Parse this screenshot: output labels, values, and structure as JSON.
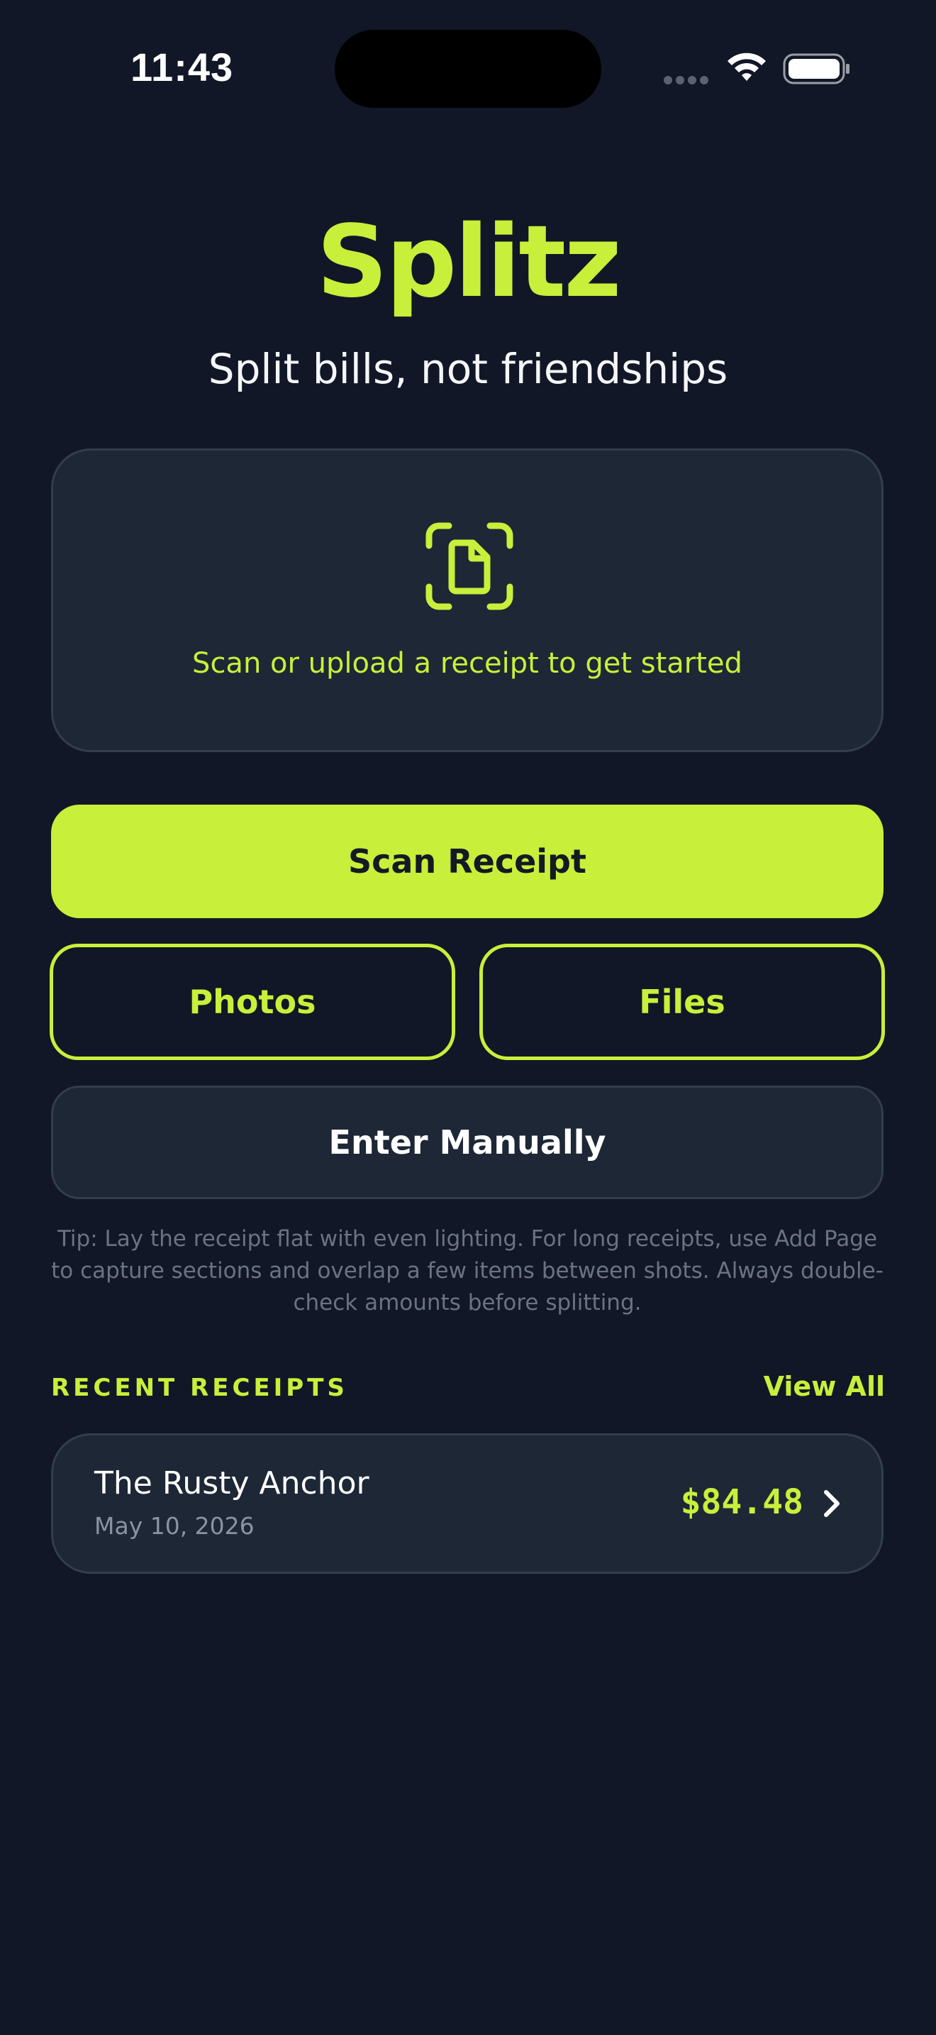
{
  "status_bar": {
    "time": "11:43"
  },
  "header": {
    "title": "Splitz",
    "tagline": "Split bills, not friendships"
  },
  "upload_card": {
    "icon": "document-scan-icon",
    "text": "Scan or upload a receipt to get started"
  },
  "actions": {
    "scan_label": "Scan Receipt",
    "photos_label": "Photos",
    "files_label": "Files",
    "manual_label": "Enter Manually"
  },
  "tip": "Tip: Lay the receipt flat with even lighting. For long receipts, use Add Page to capture sections and overlap a few items between shots. Always double-check amounts before splitting.",
  "recent": {
    "label": "RECENT RECEIPTS",
    "view_all": "View All",
    "items": [
      {
        "name": "The Rusty Anchor",
        "date": "May 10, 2026",
        "amount": "$84.48"
      }
    ]
  },
  "colors": {
    "background": "#111726",
    "accent": "#c8ef3a",
    "card": "#1d2736",
    "muted_text": "#6b7383"
  }
}
